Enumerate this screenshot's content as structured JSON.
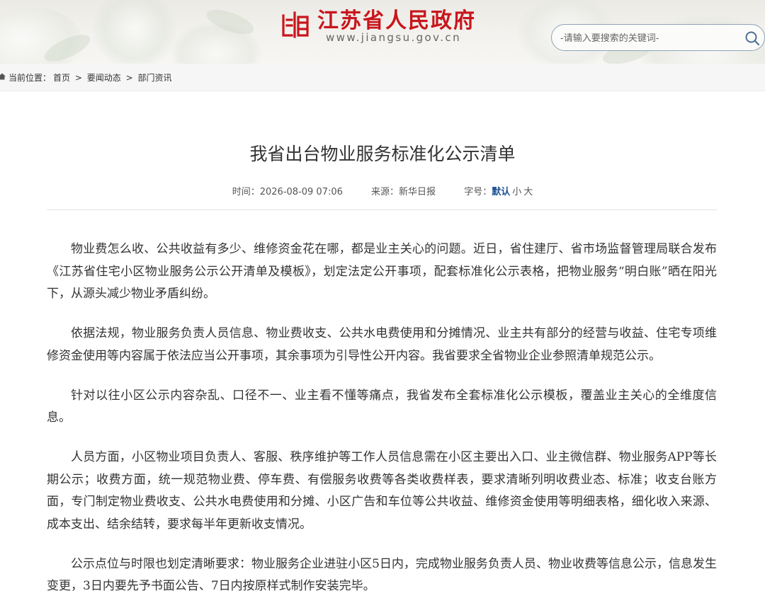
{
  "header": {
    "site_title": "江苏省人民政府",
    "site_url": "www.jiangsu.gov.cn",
    "emblem_icon": "jiangsu-gov-emblem-icon",
    "brand_color": "#c8161d",
    "search": {
      "placeholder": "-请输入要搜索的关键词-",
      "icon": "search-icon"
    }
  },
  "breadcrumb": {
    "label": "当前位置：",
    "items": [
      "首页",
      "要闻动态",
      "部门资讯"
    ],
    "separator": ">"
  },
  "article": {
    "title": "我省出台物业服务标准化公示清单",
    "meta": {
      "time_label": "时间：",
      "time_value": "2026-08-09 07:06",
      "source_label": "来源：",
      "source_value": "新华日报",
      "fontsize_label": "字号：",
      "fontsize_default": "默认",
      "fontsize_small": "小",
      "fontsize_large": "大"
    },
    "paragraphs": [
      "物业费怎么收、公共收益有多少、维修资金花在哪，都是业主关心的问题。近日，省住建厅、省市场监督管理局联合发布《江苏省住宅小区物业服务公示公开清单及模板》，划定法定公开事项，配套标准化公示表格，把物业服务“明白账”晒在阳光下，从源头减少物业矛盾纠纷。",
      "依据法规，物业服务负责人员信息、物业费收支、公共水电费使用和分摊情况、业主共有部分的经营与收益、住宅专项维修资金使用等内容属于依法应当公开事项，其余事项为引导性公开内容。我省要求全省物业企业参照清单规范公示。",
      "针对以往小区公示内容杂乱、口径不一、业主看不懂等痛点，我省发布全套标准化公示模板，覆盖业主关心的全维度信息。",
      "人员方面，小区物业项目负责人、客服、秩序维护等工作人员信息需在小区主要出入口、业主微信群、物业服务APP等长期公示；收费方面，统一规范物业费、停车费、有偿服务收费等各类收费样表，要求清晰列明收费业态、标准；收支台账方面，专门制定物业费收支、公共水电费使用和分摊、小区广告和车位等公共收益、维修资金使用等明细表格，细化收入来源、成本支出、结余结转，要求每半年更新收支情况。",
      "公示点位与时限也划定清晰要求：物业服务企业进驻小区5日内，完成物业服务负责人员、物业收费等信息公示，信息发生变更，3日内要先予书面公告、7日内按原样式制作安装完毕。"
    ]
  }
}
